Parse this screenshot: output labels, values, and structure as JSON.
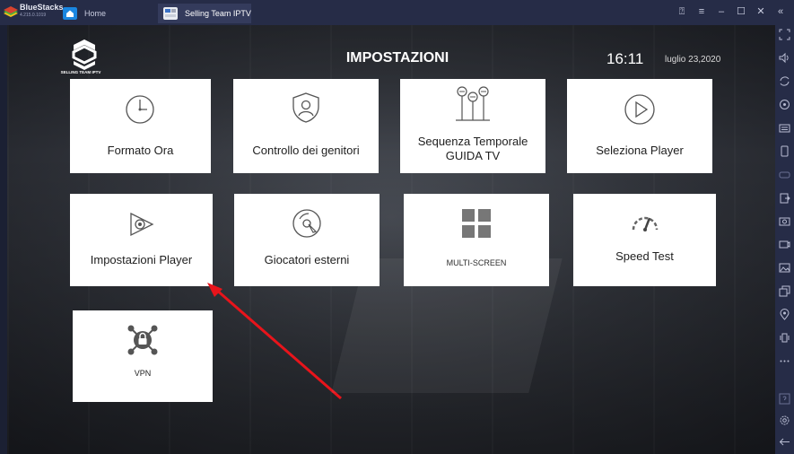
{
  "window": {
    "app_name": "BlueStacks",
    "app_version": "4.215.0.1019",
    "tabs": [
      {
        "label": "Home"
      },
      {
        "label": "Selling Team IPTV"
      }
    ],
    "controls": [
      "help-icon",
      "menu-icon",
      "minimize-icon",
      "maximize-icon",
      "close-icon",
      "collapse-icon"
    ]
  },
  "app": {
    "logo_text": "SELLING TEAM IPTV",
    "title": "IMPOSTAZIONI",
    "time": "16:11",
    "date": "luglio 23,2020"
  },
  "tiles": [
    {
      "label": "Formato Ora",
      "icon": "clock-icon"
    },
    {
      "label": "Controllo dei genitori",
      "icon": "parental-shield-icon"
    },
    {
      "label_line1": "Sequenza Temporale",
      "label_line2": "GUIDA TV",
      "icon": "timeline-icon"
    },
    {
      "label": "Seleziona Player",
      "icon": "play-circle-icon"
    },
    {
      "label": "Impostazioni Player",
      "icon": "player-settings-icon"
    },
    {
      "label": "Giocatori esterni",
      "icon": "external-player-icon"
    },
    {
      "label": "MULTI-SCREEN",
      "icon": "grid-icon"
    },
    {
      "label": "Speed Test",
      "icon": "speedometer-icon"
    },
    {
      "label": "VPN",
      "icon": "vpn-lock-icon"
    }
  ],
  "annotation": {
    "color": "#e8141b",
    "points_to": "Impostazioni Player"
  },
  "sidebar_icons": [
    "fullscreen-icon",
    "volume-icon",
    "screen-rotate-icon",
    "eye-icon",
    "keyboard-icon",
    "phone-icon",
    "gamepad-icon",
    "apk-icon",
    "screenshot-icon",
    "record-icon",
    "media-icon",
    "copy-icon",
    "location-icon",
    "shake-icon",
    "more-icon",
    "help-icon",
    "settings-icon",
    "back-icon"
  ]
}
